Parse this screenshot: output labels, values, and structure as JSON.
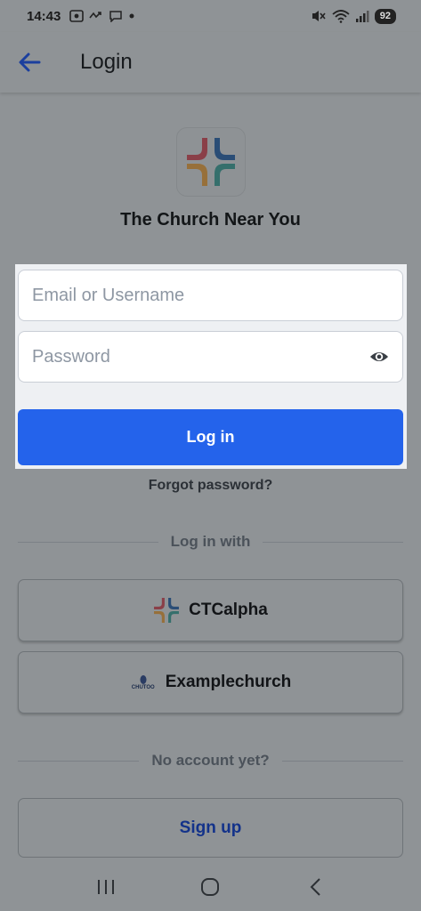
{
  "status_bar": {
    "time": "14:43",
    "left_icons": [
      "screenshot-icon",
      "missed-call-icon",
      "message-icon",
      "dot-icon"
    ],
    "right_icons": [
      "mute-icon",
      "wifi-icon",
      "signal-icon"
    ],
    "battery": "92"
  },
  "app_bar": {
    "title": "Login",
    "back_icon": "arrow-left-icon"
  },
  "logo": {
    "icon": "church-cross-logo"
  },
  "church_name": "The Church Near You",
  "form": {
    "email_placeholder": "Email or Username",
    "email_value": "",
    "password_placeholder": "Password",
    "password_value": "",
    "login_label": "Log in"
  },
  "forgot_password": "Forgot password?",
  "login_with_label": "Log in with",
  "providers": [
    {
      "label": "CTCalpha",
      "icon": "ctcalpha-logo"
    },
    {
      "label": "Examplechurch",
      "icon": "chutoo-logo",
      "icon_text": "CHUTOO"
    }
  ],
  "no_account_label": "No account yet?",
  "signup_label": "Sign up",
  "nav": [
    "recents-icon",
    "home-icon",
    "back-icon"
  ],
  "colors": {
    "primary": "#2463eb",
    "overlay_bg": "#8f9396",
    "logo_red": "#e23a48",
    "logo_blue": "#1f64b4",
    "logo_teal": "#35a9a0",
    "logo_orange": "#f09a2e"
  }
}
